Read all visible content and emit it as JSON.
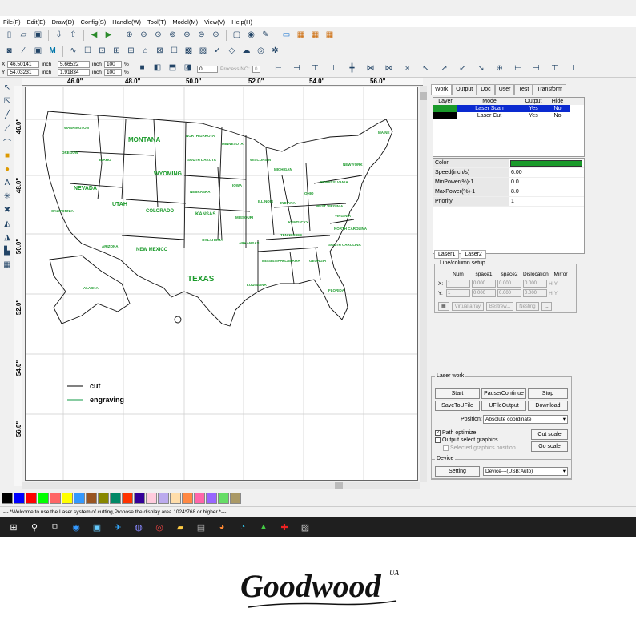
{
  "menu": [
    "File(F)",
    "Edit(E)",
    "Draw(D)",
    "Config(S)",
    "Handle(W)",
    "Tool(T)",
    "Model(M)",
    "View(V)",
    "Help(H)"
  ],
  "coords": {
    "x_label": "X",
    "x_value": "46.50141",
    "x_unit": "inch",
    "y_label": "Y",
    "y_value": "54.03231",
    "y_unit": "inch",
    "w_value": "5.66522",
    "w_unit": "inch",
    "h_value": "1.91834",
    "h_unit": "inch",
    "scale_x": "100",
    "scale_y": "100",
    "pct": "%",
    "angle": "0",
    "process_no_label": "Process NO:",
    "process_no": "0"
  },
  "ruler": {
    "h": [
      "46.0\"",
      "48.0\"",
      "50.0\"",
      "52.0\"",
      "54.0\"",
      "56.0\""
    ],
    "v": [
      "46.0\"",
      "48.0\"",
      "50.0\"",
      "52.0\"",
      "54.0\"",
      "56.0\""
    ]
  },
  "map": {
    "states": [
      "WASHINGTON",
      "OREGON",
      "IDAHO",
      "MONTANA",
      "WYOMING",
      "NORTH DAKOTA",
      "SOUTH DAKOTA",
      "MINNESOTA",
      "WISCONSIN",
      "MICHIGAN",
      "NEVADA",
      "CALIFORNIA",
      "UTAH",
      "COLORADO",
      "NEBRASKA",
      "IOWA",
      "ILLINOIS",
      "INDIANA",
      "OHIO",
      "PENNSYLVANIA",
      "NEW YORK",
      "MAINE",
      "KANSAS",
      "MISSOURI",
      "KENTUCKY",
      "WEST VIRGINIA",
      "VIRGINIA",
      "ARIZONA",
      "NEW MEXICO",
      "OKLAHOMA",
      "ARKANSAS",
      "TENNESSEE",
      "NORTH CAROLINA",
      "SOUTH CAROLINA",
      "TEXAS",
      "LOUISIANA",
      "MISSISSIPPI",
      "ALABAMA",
      "GEORGIA",
      "FLORIDA",
      "ALASKA"
    ],
    "legend": [
      {
        "label": "cut",
        "color": "#000000"
      },
      {
        "label": "engraving",
        "color": "#119944"
      }
    ]
  },
  "panel": {
    "tabs": [
      "Work",
      "Output",
      "Doc",
      "User",
      "Test",
      "Transform"
    ],
    "layer_headers": [
      "Layer",
      "Mode",
      "Output",
      "Hide"
    ],
    "layers": [
      {
        "color": "#1a9a2a",
        "mode": "Laser Scan",
        "output": "Yes",
        "hide": "No"
      },
      {
        "color": "#000000",
        "mode": "Laser Cut",
        "output": "Yes",
        "hide": "No"
      }
    ],
    "props": [
      {
        "k": "Color",
        "v": ""
      },
      {
        "k": "Speed(inch/s)",
        "v": "6.00"
      },
      {
        "k": "MinPower(%)-1",
        "v": "0.0"
      },
      {
        "k": "MaxPower(%)-1",
        "v": "8.0"
      },
      {
        "k": "Priority",
        "v": "1"
      }
    ],
    "prop_color": "#1a9a2a",
    "laser_tabs": [
      "Laser1",
      "Laser2"
    ],
    "lc_title": "Line/column setup",
    "lc_headers": [
      "Num",
      "space1",
      "space2",
      "Dislocation",
      "Mirror"
    ],
    "lc_rows": [
      {
        "axis": "X:",
        "num": "1",
        "s1": "0.000",
        "s2": "0.000",
        "dis": "0.000",
        "m1": "H",
        "m2": "Y"
      },
      {
        "axis": "Y:",
        "num": "1",
        "s1": "0.000",
        "s2": "0.000",
        "dis": "0.000",
        "m1": "H",
        "m2": "Y"
      }
    ],
    "lc_buttons": [
      "Virtual array",
      "Bestrew...",
      "Nesting",
      "..."
    ]
  },
  "laserwork": {
    "title": "Laser work",
    "start": "Start",
    "pause": "Pause/Continue",
    "stop": "Stop",
    "save": "SaveToUFile",
    "ufile": "UFileOutput",
    "download": "Download",
    "position_label": "Position:",
    "position_value": "Absolute coordinate",
    "path_optimize": "Path optimize",
    "output_select": "Output select graphics",
    "selected_pos": "Selected graphics position",
    "cut_scale": "Cut scale",
    "go_scale": "Go scale"
  },
  "device": {
    "title": "Device",
    "setting": "Setting",
    "value": "Device---(USB:Auto)"
  },
  "palette": [
    "#000000",
    "#0000ff",
    "#ff0000",
    "#00ff00",
    "#ff6666",
    "#ffff00",
    "#3399ff",
    "#995522",
    "#888800",
    "#008866",
    "#ff3300",
    "#330099",
    "#ffccdd",
    "#bbaaee",
    "#ffddaa",
    "#ff8844",
    "#ff66aa",
    "#9966ff",
    "#66dd66",
    "#aa9966"
  ],
  "status": "--- *Welcome to use the Laser system of cutting,Propose the display area 1024*768 or higher *---",
  "brand": {
    "name": "Goodwood",
    "sup": "UA"
  }
}
